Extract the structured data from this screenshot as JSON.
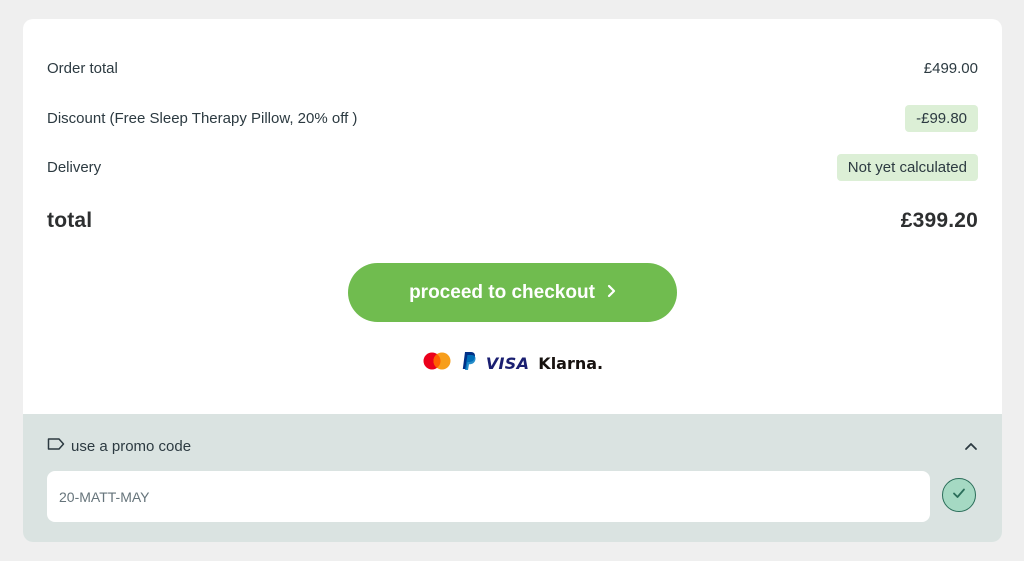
{
  "summary": {
    "order_total_label": "Order total",
    "order_total_value": "£499.00",
    "discount_label": "Discount (Free Sleep Therapy Pillow, 20% off )",
    "discount_value": "-£99.80",
    "delivery_label": "Delivery",
    "delivery_value": "Not yet calculated",
    "total_label": "total",
    "total_value": "£399.20"
  },
  "checkout": {
    "button_label": "proceed to checkout",
    "chevron_icon": "chevron-right-icon",
    "accent_color": "#70bc4f"
  },
  "payment_methods": {
    "icons": [
      "mastercard-icon",
      "paypal-icon"
    ],
    "visa_label": "VISA",
    "klarna_label": "Klarna."
  },
  "promo": {
    "toggle_label": "use a promo code",
    "tag_icon": "tag-icon",
    "collapse_icon": "chevron-up-icon",
    "code_value": "20-MATT-MAY",
    "apply_icon": "check-icon"
  },
  "colors": {
    "pill_background": "#dcefd6",
    "promo_background": "#dae3e1"
  }
}
